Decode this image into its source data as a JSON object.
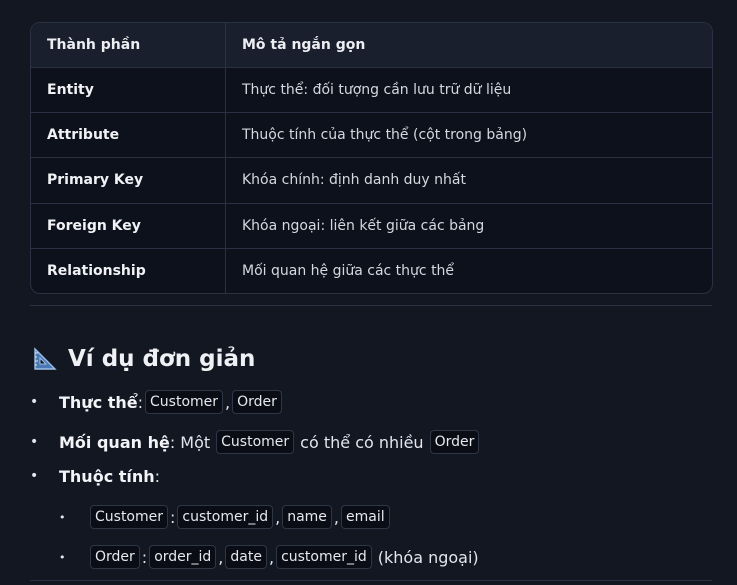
{
  "table": {
    "headers": [
      "Thành phần",
      "Mô tả ngắn gọn"
    ],
    "rows": [
      {
        "name": "Entity",
        "desc": "Thực thể: đối tượng cần lưu trữ dữ liệu"
      },
      {
        "name": "Attribute",
        "desc": "Thuộc tính của thực thể (cột trong bảng)"
      },
      {
        "name": "Primary Key",
        "desc": "Khóa chính: định danh duy nhất"
      },
      {
        "name": "Foreign Key",
        "desc": "Khóa ngoại: liên kết giữa các bảng"
      },
      {
        "name": "Relationship",
        "desc": "Mối quan hệ giữa các thực thể"
      }
    ]
  },
  "section": {
    "icon": "triangular-ruler-icon",
    "title": "Ví dụ đơn giản"
  },
  "bullets": {
    "b1": {
      "label": "Thực thể",
      "colon": ":",
      "code1": "Customer",
      "sep": ",",
      "code2": "Order"
    },
    "b2": {
      "label": "Mối quan hệ",
      "text1": ": Một",
      "code1": "Customer",
      "text2": "có thể có nhiều",
      "code2": "Order"
    },
    "b3": {
      "label": "Thuộc tính",
      "colon": ":"
    },
    "s1": {
      "code1": "Customer",
      "colon": ":",
      "code2": "customer_id",
      "sep1": ",",
      "code3": "name",
      "sep2": ",",
      "code4": "email"
    },
    "s2": {
      "code1": "Order",
      "colon": ":",
      "code2": "order_id",
      "sep1": ",",
      "code3": "date",
      "sep2": ",",
      "code4": "customer_id",
      "text": "(khóa ngoại)"
    }
  }
}
